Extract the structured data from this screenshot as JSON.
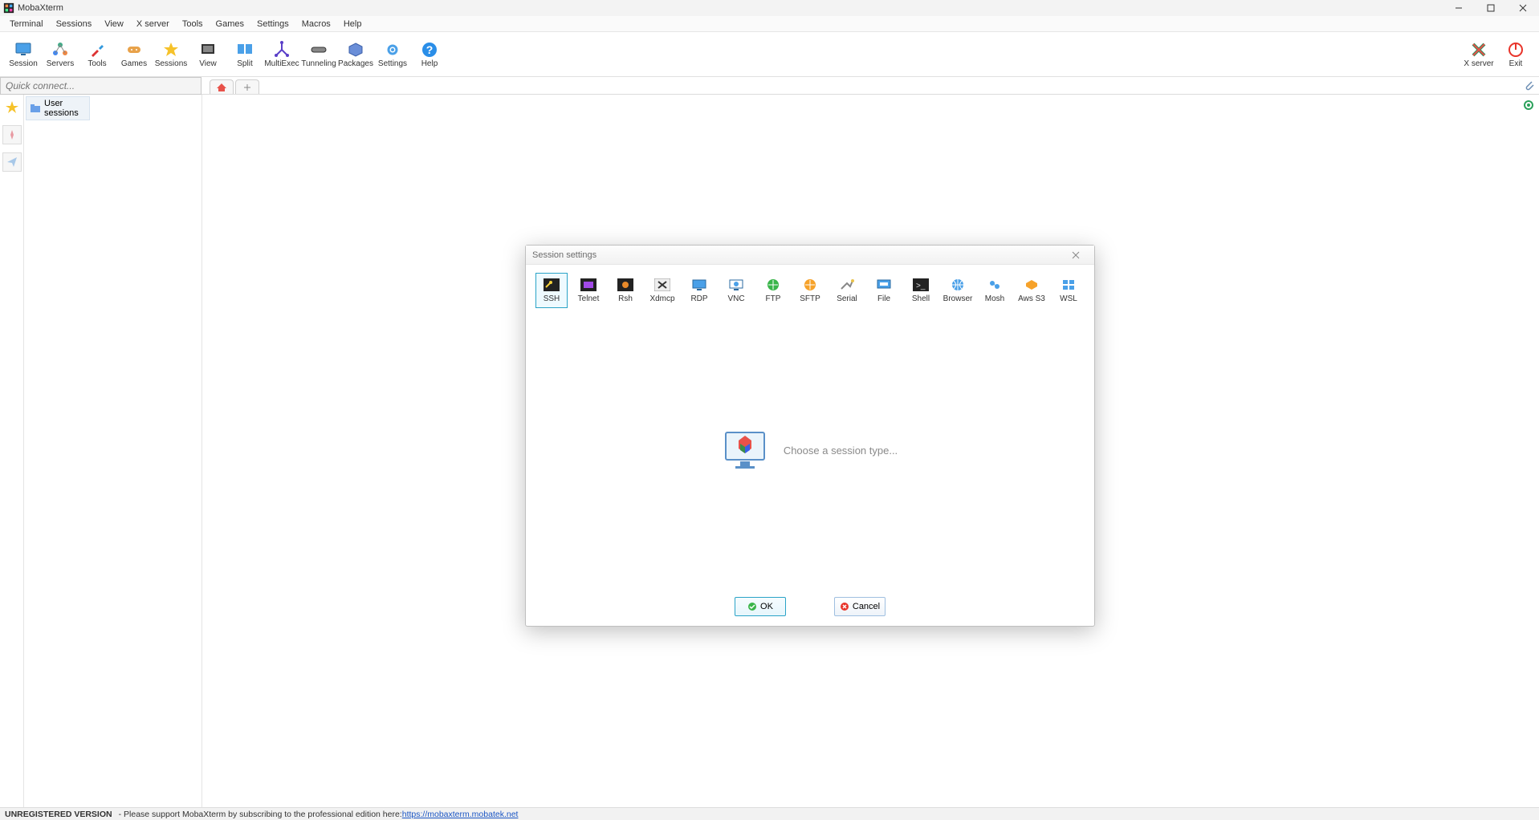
{
  "titlebar": {
    "title": "MobaXterm"
  },
  "menubar": [
    "Terminal",
    "Sessions",
    "View",
    "X server",
    "Tools",
    "Games",
    "Settings",
    "Macros",
    "Help"
  ],
  "toolbar": {
    "left": [
      "Session",
      "Servers",
      "Tools",
      "Games",
      "Sessions",
      "View",
      "Split",
      "MultiExec",
      "Tunneling",
      "Packages",
      "Settings",
      "Help"
    ],
    "right": [
      "X server",
      "Exit"
    ]
  },
  "quickconnect": {
    "placeholder": "Quick connect..."
  },
  "sidepanel": {
    "tree_root": "User sessions"
  },
  "dialog": {
    "title": "Session settings",
    "prompt": "Choose a session type...",
    "types": [
      "SSH",
      "Telnet",
      "Rsh",
      "Xdmcp",
      "RDP",
      "VNC",
      "FTP",
      "SFTP",
      "Serial",
      "File",
      "Shell",
      "Browser",
      "Mosh",
      "Aws S3",
      "WSL"
    ],
    "selected": "SSH",
    "ok": "OK",
    "cancel": "Cancel"
  },
  "footer": {
    "badge": "UNREGISTERED VERSION",
    "text": "Please support MobaXterm by subscribing to the professional edition here: ",
    "link": "https://mobaxterm.mobatek.net"
  }
}
